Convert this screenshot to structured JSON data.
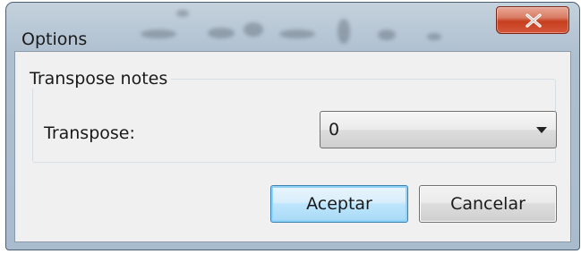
{
  "window": {
    "title": "Options"
  },
  "groupbox": {
    "title": "Transpose notes"
  },
  "transpose": {
    "label": "Transpose:",
    "selected_value": "0"
  },
  "buttons": {
    "accept_label": "Aceptar",
    "cancel_label": "Cancelar"
  },
  "colors": {
    "close_button": "#c63f1f",
    "accept_border": "#3c7fb1",
    "dialog_background": "#f0f0f0"
  },
  "icons": {
    "close": "close-icon",
    "dropdown": "chevron-down-icon"
  }
}
